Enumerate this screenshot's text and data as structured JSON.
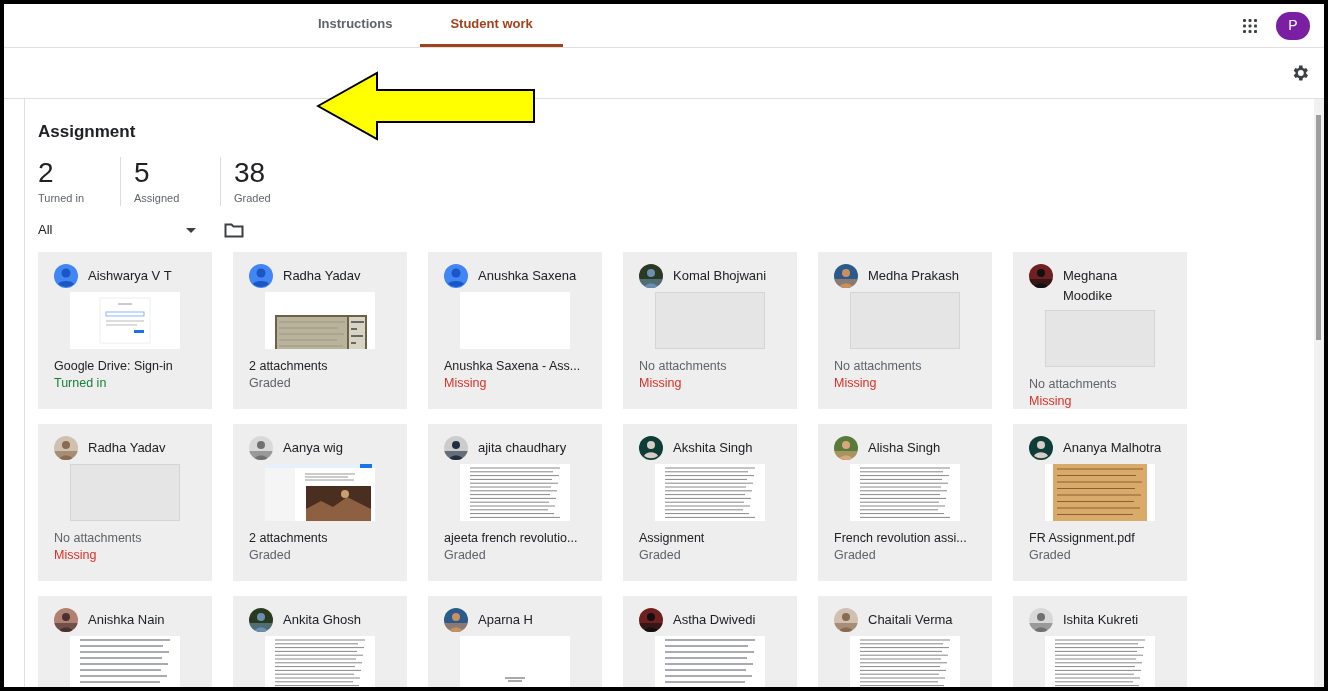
{
  "tabs": [
    {
      "label": "Instructions",
      "selected": false
    },
    {
      "label": "Student work",
      "selected": true
    }
  ],
  "account": {
    "initial": "P"
  },
  "title": "Assignment",
  "stats": [
    {
      "value": "2",
      "label": "Turned in"
    },
    {
      "value": "5",
      "label": "Assigned"
    },
    {
      "value": "38",
      "label": "Graded"
    }
  ],
  "filter": {
    "value": "All"
  },
  "cards": [
    {
      "name": "Aishwarya V T",
      "avatar": {
        "kind": "default"
      },
      "thumbnail": {
        "kind": "signin"
      },
      "attachment": "Google Drive: Sign-in",
      "status": {
        "text": "Turned in",
        "kind": "turned_in"
      }
    },
    {
      "name": "Radha Yadav",
      "avatar": {
        "kind": "default"
      },
      "attachment": "2 attachments",
      "status": {
        "text": "Graded",
        "kind": "graded"
      }
    },
    {
      "name": "Anushka Saxena",
      "avatar": {
        "kind": "default"
      },
      "thumbnail": {
        "kind": "blank"
      },
      "attachment": "Anushka Saxena - Ass...",
      "status": {
        "text": "Missing",
        "kind": "missing"
      }
    },
    {
      "name": "Komal Bhojwani",
      "thumbnail": {
        "kind": "empty"
      },
      "attachment": "No attachments",
      "status": {
        "text": "Missing",
        "kind": "missing"
      }
    },
    {
      "name": "Medha Prakash",
      "thumbnail": {
        "kind": "empty"
      },
      "attachment": "No attachments",
      "status": {
        "text": "Missing",
        "kind": "missing"
      }
    },
    {
      "name": "Meghana Moodike",
      "thumbnail": {
        "kind": "empty"
      },
      "attachment": "No attachments",
      "status": {
        "text": "Missing",
        "kind": "missing"
      }
    },
    {
      "name": "Radha Yadav",
      "thumbnail": {
        "kind": "empty"
      },
      "attachment": "No attachments",
      "status": {
        "text": "Missing",
        "kind": "missing"
      }
    },
    {
      "name": "Aanya wig",
      "thumbnail": {
        "kind": "webpage"
      },
      "attachment": "2 attachments",
      "status": {
        "text": "Graded",
        "kind": "graded"
      }
    },
    {
      "name": "ajita chaudhary",
      "thumbnail": {
        "kind": "document"
      },
      "attachment": "ajeeta french revolutio...",
      "status": {
        "text": "Graded",
        "kind": "graded"
      }
    },
    {
      "name": "Akshita Singh",
      "avatar": {
        "kind": "silhouette"
      },
      "thumbnail": {
        "kind": "document"
      },
      "attachment": "Assignment",
      "status": {
        "text": "Graded",
        "kind": "graded"
      }
    },
    {
      "name": "Alisha Singh",
      "thumbnail": {
        "kind": "document"
      },
      "attachment": "French revolution assi...",
      "status": {
        "text": "Graded",
        "kind": "graded"
      }
    },
    {
      "name": "Ananya Malhotra",
      "avatar": {
        "kind": "silhouette"
      },
      "thumbnail": {
        "kind": "paper"
      },
      "attachment": "FR Assignment.pdf",
      "status": {
        "text": "Graded",
        "kind": "graded"
      }
    },
    {
      "name": "Anishka Nain",
      "thumbnail": {
        "kind": "handwritten"
      }
    },
    {
      "name": "Ankita Ghosh",
      "thumbnail": {
        "kind": "document"
      }
    },
    {
      "name": "Aparna H",
      "thumbnail": {
        "kind": "titlepage"
      }
    },
    {
      "name": "Astha Dwivedi",
      "thumbnail": {
        "kind": "handwritten"
      }
    },
    {
      "name": "Chaitali Verma",
      "thumbnail": {
        "kind": "document"
      }
    },
    {
      "name": "Ishita Kukreti",
      "thumbnail": {
        "kind": "document"
      }
    }
  ]
}
